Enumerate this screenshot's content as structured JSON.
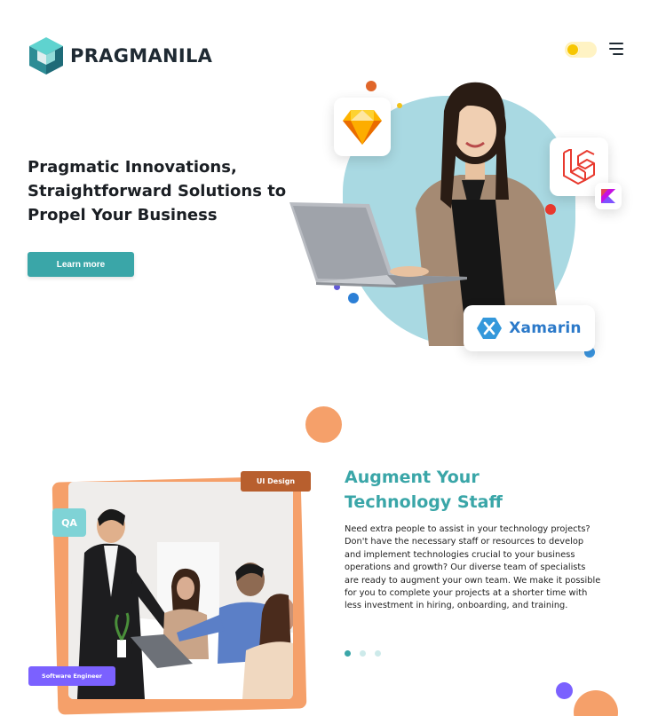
{
  "header": {
    "brand": "PRAGMANILA",
    "theme_toggle": "theme-toggle",
    "menu_icon": "hamburger-icon"
  },
  "hero": {
    "title": "Pragmatic Innovations, Straightforward Solutions to Propel Your Business",
    "cta_label": "Learn more",
    "tech_badges": [
      "sketch-icon",
      "laravel-icon",
      "kotlin-icon"
    ],
    "xamarin_label": "Xamarin"
  },
  "staff": {
    "tags": {
      "qa": "QA",
      "ui_design": "UI Design",
      "software_engineer": "Software Engineer"
    },
    "title_line1": "Augment Your",
    "title_line2": "Technology Staff",
    "body": "Need extra people to assist in your technology projects? Don't have the necessary staff or resources to develop and implement technologies crucial to your business operations and growth? Our diverse team of specialists are ready to augment your own team. We make it possible for you to complete your projects at a shorter time with less investment in hiring, onboarding, and training.",
    "carousel": {
      "count": 3,
      "active": 1
    }
  },
  "colors": {
    "teal": "#3aa6a8",
    "orange": "#f5a06a",
    "purple": "#7b61ff",
    "ui_design_tag": "#b85f2e",
    "qa_tag": "#7fd3d6"
  }
}
